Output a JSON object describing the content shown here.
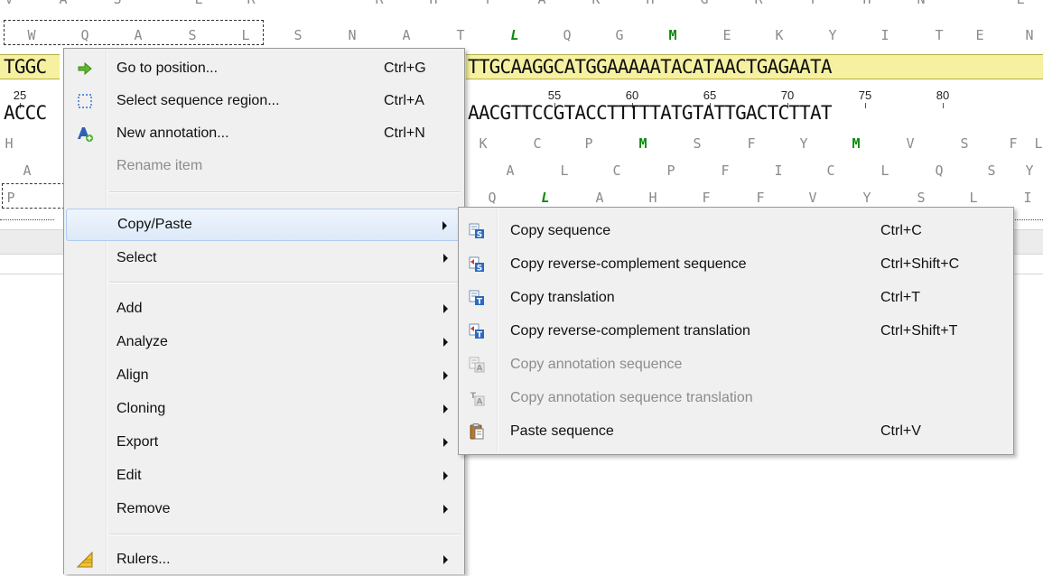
{
  "sequence": {
    "top_letters": [
      "V",
      "A",
      "S",
      "L",
      "R",
      "R",
      "H",
      "T",
      "A",
      "K",
      "H",
      "G",
      "R",
      "T",
      "H",
      "N",
      "L"
    ],
    "aa_row1": [
      "W",
      "Q",
      "A",
      "S",
      "L",
      "S",
      "N",
      "A",
      "T",
      "L",
      "Q",
      "G",
      "M",
      "E",
      "K",
      "Y",
      "I",
      "T",
      "E",
      "N"
    ],
    "dna_left": "TGGC",
    "dna_right": "TTGCAAGGCATGGAAAAATACATAACTGAGAATA",
    "ruler_left": "25",
    "ruler_ticks": [
      "55",
      "60",
      "65",
      "70",
      "75",
      "80"
    ],
    "dna_bottom_left": "ACCC",
    "dna_bottom_right": "AACGTTCCGTACCTTTTTATGTATTGACTCTTAT",
    "aa_row2_left": "H",
    "aa_row2": [
      "K",
      "C",
      "P",
      "M",
      "S",
      "F",
      "Y",
      "M",
      "V",
      "S",
      "F",
      "L"
    ],
    "aa_row3_left": "A",
    "aa_row3": [
      "A",
      "L",
      "C",
      "P",
      "F",
      "I",
      "C",
      "L",
      "Q",
      "S",
      "Y"
    ],
    "aa_row4_left": "P",
    "aa_row4": [
      "Q",
      "L",
      "A",
      "H",
      "F",
      "F",
      "V",
      "Y",
      "S",
      "L",
      "I"
    ]
  },
  "context_menu": {
    "items": [
      {
        "label": "Go to position...",
        "shortcut": "Ctrl+G",
        "icon": "green-arrow-icon"
      },
      {
        "label": "Select sequence region...",
        "shortcut": "Ctrl+A",
        "icon": "dashed-selection-icon"
      },
      {
        "label": "New annotation...",
        "shortcut": "Ctrl+N",
        "icon": "new-annotation-icon"
      },
      {
        "label": "Rename item",
        "shortcut": "",
        "disabled": true
      },
      {
        "label": "Copy/Paste",
        "submenu": true
      },
      {
        "label": "Select",
        "submenu": true
      },
      {
        "label": "Add",
        "submenu": true
      },
      {
        "label": "Analyze",
        "submenu": true
      },
      {
        "label": "Align",
        "submenu": true
      },
      {
        "label": "Cloning",
        "submenu": true
      },
      {
        "label": "Export",
        "submenu": true
      },
      {
        "label": "Edit",
        "submenu": true
      },
      {
        "label": "Remove",
        "submenu": true
      },
      {
        "label": "Rulers...",
        "submenu": true,
        "icon": "ruler-icon"
      }
    ]
  },
  "copy_paste_submenu": {
    "items": [
      {
        "label": "Copy sequence",
        "shortcut": "Ctrl+C",
        "icon": "copy-sequence-icon"
      },
      {
        "label": "Copy reverse-complement sequence",
        "shortcut": "Ctrl+Shift+C",
        "icon": "copy-revcomp-sequence-icon"
      },
      {
        "label": "Copy translation",
        "shortcut": "Ctrl+T",
        "icon": "copy-translation-icon"
      },
      {
        "label": "Copy reverse-complement translation",
        "shortcut": "Ctrl+Shift+T",
        "icon": "copy-revcomp-translation-icon"
      },
      {
        "label": "Copy annotation sequence",
        "shortcut": "",
        "disabled": true,
        "icon": "copy-annotation-sequence-icon"
      },
      {
        "label": "Copy annotation sequence translation",
        "shortcut": "",
        "disabled": true,
        "icon": "copy-annotation-translation-icon"
      },
      {
        "label": "Paste sequence",
        "shortcut": "Ctrl+V",
        "icon": "paste-icon"
      }
    ]
  },
  "colors": {
    "highlight_yellow": "#f6f1a0",
    "menu_bg": "#f0f0f0",
    "hover_blue": "#dde9f8",
    "green_aa": "#0a8a0a"
  }
}
